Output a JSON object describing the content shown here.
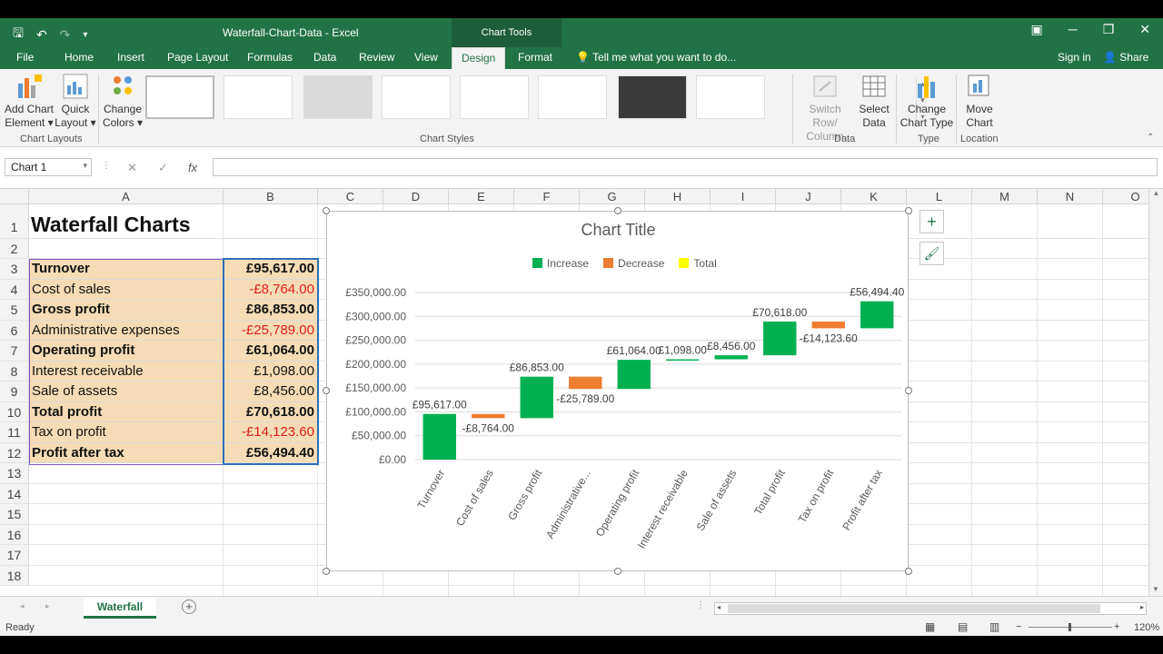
{
  "window": {
    "title": "Waterfall-Chart-Data - Excel",
    "context_tab": "Chart Tools"
  },
  "tabs": [
    "File",
    "Home",
    "Insert",
    "Page Layout",
    "Formulas",
    "Data",
    "Review",
    "View",
    "Design",
    "Format"
  ],
  "active_tab": "Design",
  "tell_me": "Tell me what you want to do...",
  "account": {
    "signin": "Sign in",
    "share": "Share"
  },
  "ribbon": {
    "add_chart_element": [
      "Add Chart",
      "Element"
    ],
    "quick_layout": [
      "Quick",
      "Layout"
    ],
    "change_colors": [
      "Change",
      "Colors"
    ],
    "chart_layouts_label": "Chart Layouts",
    "chart_styles_label": "Chart Styles",
    "switch_row_column": [
      "Switch Row/",
      "Column"
    ],
    "select_data": [
      "Select",
      "Data"
    ],
    "data_label": "Data",
    "change_chart_type": [
      "Change",
      "Chart Type"
    ],
    "type_label": "Type",
    "move_chart": [
      "Move",
      "Chart"
    ],
    "location_label": "Location"
  },
  "name_box": "Chart 1",
  "formula_value": "",
  "columns": [
    "A",
    "B",
    "C",
    "D",
    "E",
    "F",
    "G",
    "H",
    "I",
    "J",
    "K",
    "L",
    "M",
    "N",
    "O"
  ],
  "rows": [
    "1",
    "2",
    "3",
    "4",
    "5",
    "6",
    "7",
    "8",
    "9",
    "10",
    "11",
    "12",
    "13",
    "14",
    "15",
    "16",
    "17",
    "18"
  ],
  "sheet": {
    "title": "Waterfall Charts",
    "items": [
      {
        "label": "Turnover",
        "value": "£95,617.00",
        "bold": true,
        "neg": false
      },
      {
        "label": "Cost of sales",
        "value": "-£8,764.00",
        "bold": false,
        "neg": true
      },
      {
        "label": "Gross profit",
        "value": "£86,853.00",
        "bold": true,
        "neg": false
      },
      {
        "label": "Administrative expenses",
        "value": "-£25,789.00",
        "bold": false,
        "neg": true
      },
      {
        "label": "Operating profit",
        "value": "£61,064.00",
        "bold": true,
        "neg": false
      },
      {
        "label": "Interest receivable",
        "value": "£1,098.00",
        "bold": false,
        "neg": false
      },
      {
        "label": "Sale of assets",
        "value": "£8,456.00",
        "bold": false,
        "neg": false
      },
      {
        "label": "Total profit",
        "value": "£70,618.00",
        "bold": true,
        "neg": false
      },
      {
        "label": "Tax on profit",
        "value": "-£14,123.60",
        "bold": false,
        "neg": true
      },
      {
        "label": "Profit after tax",
        "value": "£56,494.40",
        "bold": true,
        "neg": false
      }
    ]
  },
  "sheet_tab": "Waterfall",
  "status": "Ready",
  "zoom": "120%",
  "colors": {
    "increase": "#00b050",
    "decrease": "#ed7d31",
    "total": "#ffff00",
    "excel_green": "#217346"
  },
  "chart_data": {
    "type": "bar",
    "title": "Chart Title",
    "legend": [
      "Increase",
      "Decrease",
      "Total"
    ],
    "legend_position": "top",
    "categories": [
      "Turnover",
      "Cost of sales",
      "Gross profit",
      "Administrative...",
      "Operating profit",
      "Interest receivable",
      "Sale of assets",
      "Total profit",
      "Tax on profit",
      "Profit after tax"
    ],
    "bars": [
      {
        "kind": "increase",
        "low": 0,
        "high": 95617,
        "label": "£95,617.00"
      },
      {
        "kind": "decrease",
        "low": 86853,
        "high": 95617,
        "label": "-£8,764.00"
      },
      {
        "kind": "increase",
        "low": 86853,
        "high": 173706,
        "label": "£86,853.00"
      },
      {
        "kind": "decrease",
        "low": 147917,
        "high": 173706,
        "label": "-£25,789.00"
      },
      {
        "kind": "increase",
        "low": 147917,
        "high": 208981,
        "label": "£61,064.00"
      },
      {
        "kind": "increase",
        "low": 208981,
        "high": 210079,
        "label": "£1,098.00"
      },
      {
        "kind": "increase",
        "low": 210079,
        "high": 218535,
        "label": "£8,456.00"
      },
      {
        "kind": "increase",
        "low": 218535,
        "high": 289153,
        "label": "£70,618.00"
      },
      {
        "kind": "decrease",
        "low": 275029.4,
        "high": 289153,
        "label": "-£14,123.60"
      },
      {
        "kind": "increase",
        "low": 275029.4,
        "high": 331523.8,
        "label": "£56,494.40"
      }
    ],
    "y_ticks": [
      "£0.00",
      "£50,000.00",
      "£100,000.00",
      "£150,000.00",
      "£200,000.00",
      "£250,000.00",
      "£300,000.00",
      "£350,000.00"
    ],
    "ylim": [
      0,
      350000
    ],
    "grid": true
  }
}
